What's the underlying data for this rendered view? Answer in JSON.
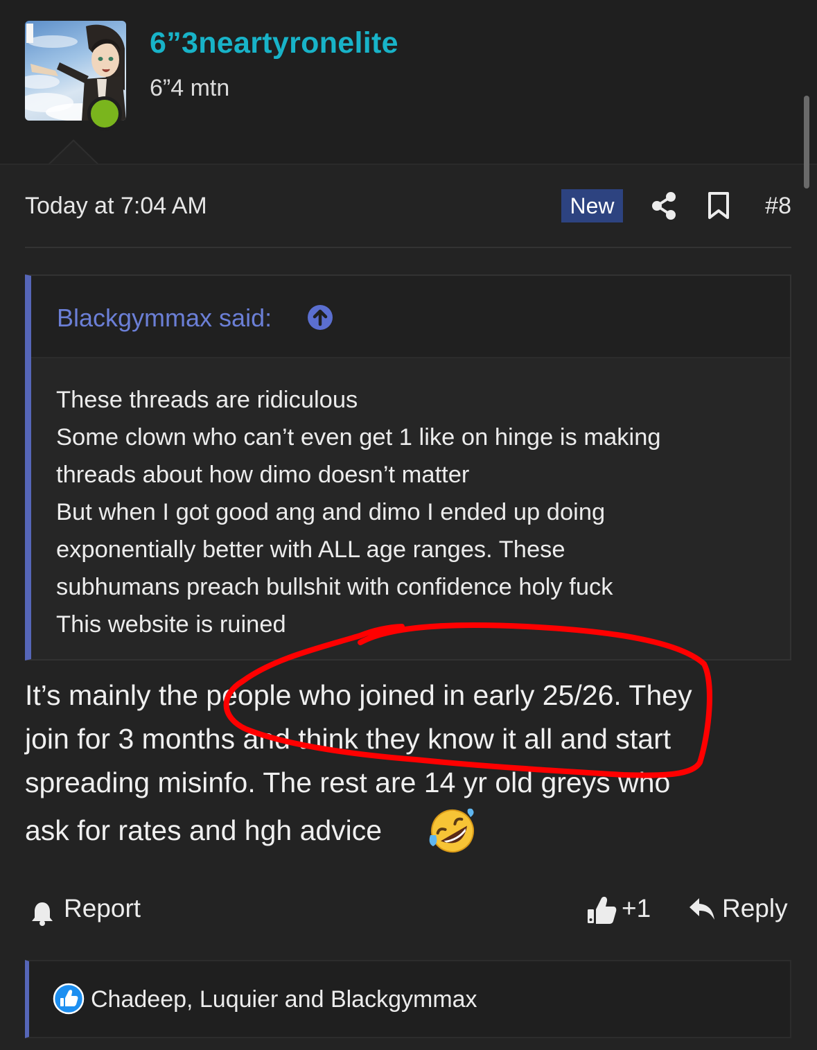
{
  "user": {
    "username": "6”3neartyronelite",
    "title": "6”4 mtn",
    "status": "online",
    "avatar": "anime-character-avatar"
  },
  "post": {
    "date": "Today at 7:04 AM",
    "badge": "New",
    "number": "#8",
    "icons": [
      "share-icon",
      "bookmark-icon"
    ]
  },
  "quote": {
    "author_line": "Blackgymmax said:",
    "icon": "arrow-up-circle-icon",
    "lines": [
      "These threads are ridiculous",
      "Some clown who can’t even get 1 like on hinge is making",
      "threads about how dimo doesn’t matter",
      "But when I got good ang and dimo I ended up doing",
      "exponentially better with ALL age ranges. These",
      "subhumans preach bullshit with confidence holy fuck",
      "This website is ruined"
    ]
  },
  "message": {
    "lines": [
      "It’s mainly the people who joined in early 25/26. They",
      "join for 3 months and think they know it all and start",
      "spreading misinfo. The rest are 14 yr old greys who",
      "ask for rates and hgh advice"
    ],
    "emoji": "rolling-on-floor-laughing",
    "annotation_color": "#ff0000"
  },
  "actions": {
    "report": "Report",
    "like_count": "+1",
    "reply": "Reply"
  },
  "reactions": {
    "icon": "thumbs-up-icon",
    "users": "Chadeep, Luquier and Blackgymmax"
  },
  "colors": {
    "background": "#232323",
    "username": "#18b3c8",
    "quote_accent": "#5666b8",
    "badge": "#2d4380",
    "online": "#7ab51d"
  }
}
